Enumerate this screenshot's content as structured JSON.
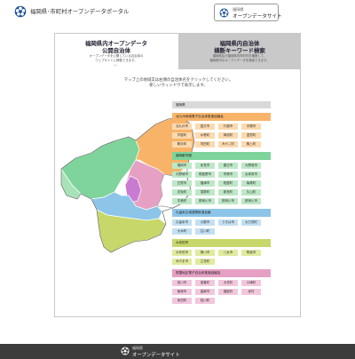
{
  "header": {
    "site_title": "福岡県･市町村オープンデータポータル",
    "opendata_button": {
      "line1": "福岡県",
      "line2": "オープンデータサイト"
    }
  },
  "tabs": [
    {
      "title1": "福岡県内オープンデータ",
      "title2": "公開自治体",
      "desc": "オープンデータを公開している自治体の\nウェブサイトに移動できます。",
      "arrow": "﹀"
    },
    {
      "title1": "福岡県内自治体",
      "title2": "横断キーワード検索",
      "desc": "福岡県及び福岡県内市町村を横断して、\n福岡県内のオープンデータを検索できます。"
    }
  ],
  "instructions": "マップ上の地域又は右側の自治体名をクリックしてください。\n新しいウィンドウで表示します。",
  "legend": {
    "prefecture": "福岡県",
    "groups": [
      {
        "name": "北九州地域電子自治体推進協議会",
        "color": "#f7b469",
        "chip_color": "#fcd9ae",
        "items": [
          "北九州市",
          "直方市",
          "行橋市",
          "中間市",
          "芦屋町",
          "水巻町",
          "岡垣町",
          "遠賀町",
          "鞍手町",
          "苅田町",
          "みやこ町",
          "築上町"
        ]
      },
      {
        "name": "福岡都市圏",
        "color": "#7ed49a",
        "chip_color": "#bde8c6",
        "items": [
          "福岡市",
          "糸島市",
          "春日市",
          "大野城市",
          "大野城市",
          "筑紫野市",
          "宗像市",
          "太宰府市",
          "古賀市",
          "福津市",
          "粕屋町",
          "篠栗町",
          "志免町",
          "須恵町",
          "新宮町",
          "久山町",
          "宇美町",
          "那珂川市",
          "那珂川市",
          "那珂川市"
        ]
      },
      {
        "name": "久留米広域連携推進会議",
        "color": "#8cc5e8",
        "chip_color": "#c2e0f3",
        "items": [
          "久留米市",
          "小郡市",
          "うきは市",
          "大刀洗町",
          "大木町",
          "広川町"
        ]
      },
      {
        "name": "大牟田市",
        "color": "#c8d76a",
        "chip_color": "#e2ea9d",
        "items": [
          "大牟田市",
          "柳川市",
          "八女市",
          "筑後市",
          "みやま市",
          "立花町"
        ]
      },
      {
        "name": "筑豊地区電子自治体推進協議会",
        "color": "#e6a0c4",
        "chip_color": "#f2c7de",
        "items": [
          "田川市",
          "香春町",
          "大任町",
          "川崎町",
          "飯塚市",
          "嘉麻市",
          "福智町",
          "赤村",
          "糸田町",
          "桂川町"
        ]
      }
    ],
    "extra_rows": [
      [
        "福岡市",
        "糸島市",
        "春日市",
        "大野城市"
      ],
      [
        "大野城市",
        "筑紫野市",
        "宗像市",
        "太宰府市"
      ],
      [
        "古賀市",
        "福津市",
        "粕屋町",
        "篠栗町"
      ],
      [
        "志免町",
        "須恵町",
        "新宮町",
        "久山町"
      ],
      [
        "宇美町"
      ]
    ]
  },
  "footer": {
    "line1": "福岡県",
    "line2": "オープンデータサイト"
  },
  "colors": {
    "orange": "#f7b469",
    "green": "#7ed49a",
    "blue": "#8cc5e8",
    "yellow": "#c8d76a",
    "pink": "#e6a0c4",
    "purple": "#c97bd1",
    "white_region": "#ffffff"
  }
}
